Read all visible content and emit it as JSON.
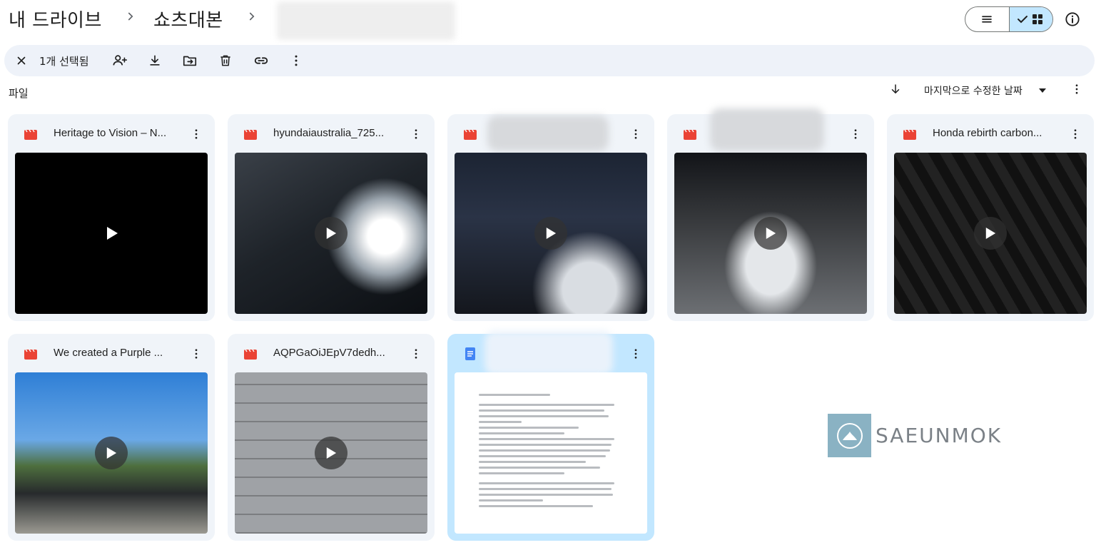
{
  "header": {
    "crumbs": [
      "내 드라이브",
      "쇼츠대본"
    ]
  },
  "toolbar": {
    "selected_count": "1개 선택됨"
  },
  "section": {
    "label": "파일",
    "sort_label": "마지막으로 수정한 날짜"
  },
  "files": [
    {
      "name": "Heritage to Vision – N...",
      "type": "video"
    },
    {
      "name": "hyundaiaustralia_725...",
      "type": "video"
    },
    {
      "name": "",
      "type": "video"
    },
    {
      "name": "",
      "type": "video"
    },
    {
      "name": "Honda rebirth carbon...",
      "type": "video"
    },
    {
      "name": "We created a Purple ...",
      "type": "video"
    },
    {
      "name": "AQPGaOiJEpV7dedh...",
      "type": "video"
    },
    {
      "name": "",
      "type": "document"
    }
  ],
  "watermark": {
    "text": "SAEUNMOK"
  },
  "colors": {
    "accent": "#c2e7ff",
    "toolbar_bg": "#eef2f9",
    "card_bg": "#f0f4f9",
    "video_icon": "#ea4335",
    "doc_icon": "#4285f4"
  }
}
